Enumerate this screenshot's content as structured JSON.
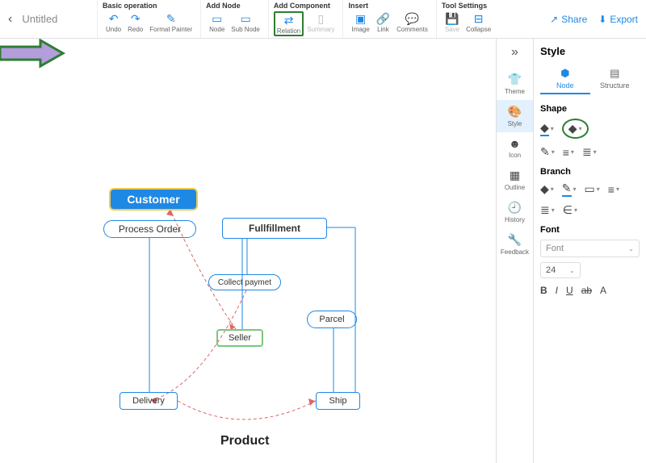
{
  "doc": {
    "title": "Untitled"
  },
  "toolbar": {
    "groups": {
      "basic": {
        "title": "Basic operation",
        "undo": "Undo",
        "redo": "Redo",
        "format_painter": "Format Painter"
      },
      "add_node": {
        "title": "Add Node",
        "node": "Node",
        "sub_node": "Sub Node"
      },
      "add_component": {
        "title": "Add Component",
        "relation": "Relation",
        "summary": "Summary"
      },
      "insert": {
        "title": "Insert",
        "image": "Image",
        "link": "Link",
        "comments": "Comments"
      },
      "tool_settings": {
        "title": "Tool Settings",
        "save": "Save",
        "collapse": "Collapse"
      }
    },
    "share": "Share",
    "export": "Export"
  },
  "rail": {
    "theme": "Theme",
    "style": "Style",
    "icon": "Icon",
    "outline": "Outline",
    "history": "History",
    "feedback": "Feedback"
  },
  "panel": {
    "title": "Style",
    "tabs": {
      "node": "Node",
      "structure": "Structure"
    },
    "shape": "Shape",
    "branch": "Branch",
    "font_section": "Font",
    "font_placeholder": "Font",
    "font_size": "24",
    "format": {
      "bold": "B",
      "italic": "I",
      "underline": "U",
      "strike": "ab",
      "color": "A"
    }
  },
  "canvas": {
    "customer": "Customer",
    "process_order": "Process Order",
    "fulfillment": "Fullfillment",
    "collect_payment": "Collect paymet",
    "seller": "Seller",
    "parcel": "Parcel",
    "delivery": "Delivery",
    "ship": "Ship",
    "product": "Product"
  }
}
